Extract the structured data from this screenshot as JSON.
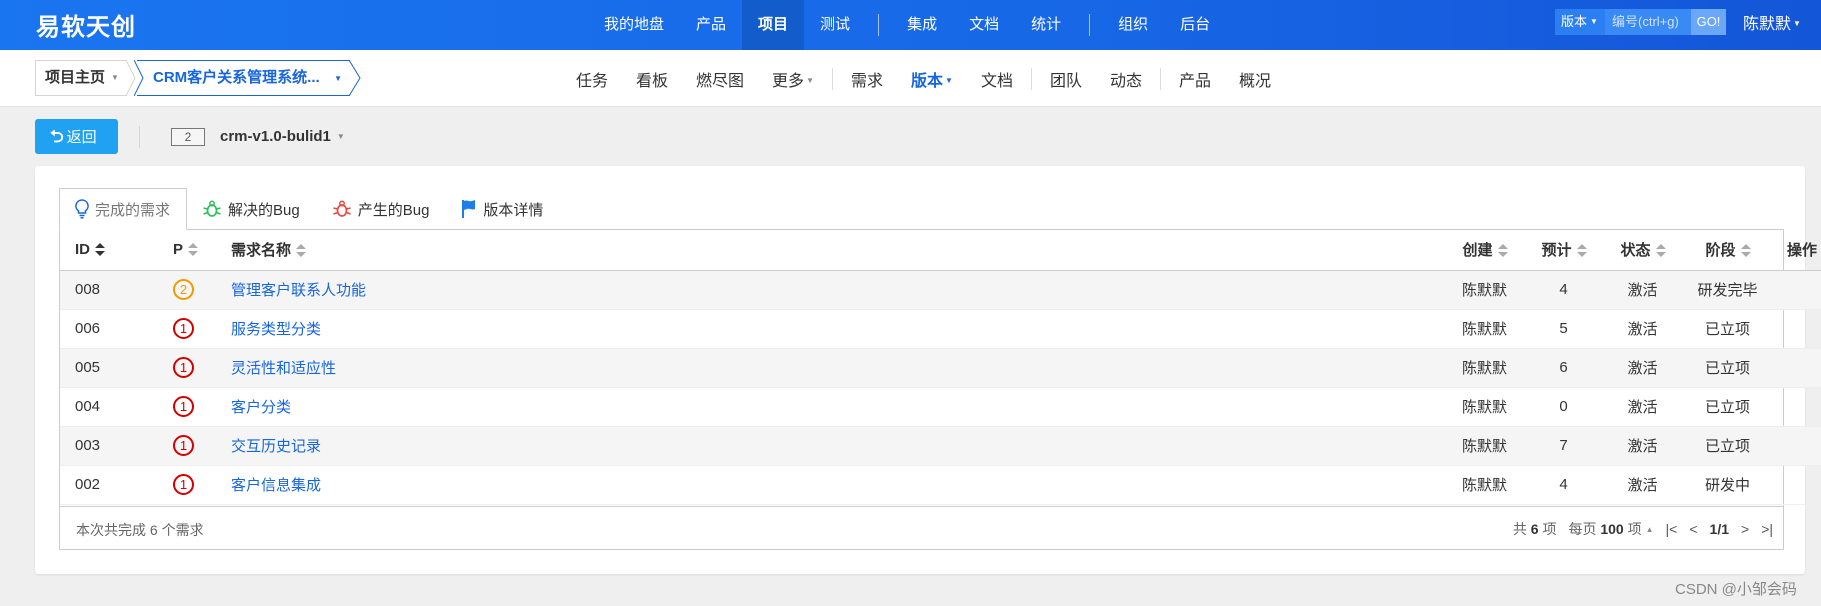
{
  "header": {
    "brand": "易软天创",
    "nav": [
      {
        "label": "我的地盘"
      },
      {
        "label": "产品"
      },
      {
        "label": "项目",
        "active": true
      },
      {
        "label": "测试"
      },
      {
        "label": "集成"
      },
      {
        "label": "文档"
      },
      {
        "label": "统计"
      },
      {
        "label": "组织"
      },
      {
        "label": "后台"
      }
    ],
    "search": {
      "type": "版本",
      "placeholder": "编号(ctrl+g)",
      "go": "GO!"
    },
    "user": "陈默默"
  },
  "subheader": {
    "home": "项目主页",
    "project": "CRM客户关系管理系统...",
    "nav": [
      {
        "label": "任务"
      },
      {
        "label": "看板"
      },
      {
        "label": "燃尽图"
      },
      {
        "label": "更多"
      },
      {
        "label": "需求"
      },
      {
        "label": "版本",
        "active": true
      },
      {
        "label": "文档"
      },
      {
        "label": "团队"
      },
      {
        "label": "动态"
      },
      {
        "label": "产品"
      },
      {
        "label": "概况"
      }
    ]
  },
  "toolbar": {
    "back": "返回",
    "version_id": "2",
    "version_name": "crm-v1.0-bulid1"
  },
  "tabs": [
    {
      "label": "完成的需求",
      "icon": "lightbulb-icon",
      "active": true
    },
    {
      "label": "解决的Bug",
      "icon": "bug-icon"
    },
    {
      "label": "产生的Bug",
      "icon": "bug-icon"
    },
    {
      "label": "版本详情",
      "icon": "flag-icon"
    }
  ],
  "table": {
    "columns": {
      "id": "ID",
      "pri": "P",
      "name": "需求名称",
      "creator": "创建",
      "estimate": "预计",
      "status": "状态",
      "stage": "阶段",
      "actions": "操作"
    },
    "rows": [
      {
        "id": "008",
        "pri": "2",
        "name": "管理客户联系人功能",
        "creator": "陈默默",
        "estimate": "4",
        "status": "激活",
        "stage": "研发完毕"
      },
      {
        "id": "006",
        "pri": "1",
        "name": "服务类型分类",
        "creator": "陈默默",
        "estimate": "5",
        "status": "激活",
        "stage": "已立项"
      },
      {
        "id": "005",
        "pri": "1",
        "name": "灵活性和适应性",
        "creator": "陈默默",
        "estimate": "6",
        "status": "激活",
        "stage": "已立项"
      },
      {
        "id": "004",
        "pri": "1",
        "name": "客户分类",
        "creator": "陈默默",
        "estimate": "0",
        "status": "激活",
        "stage": "已立项"
      },
      {
        "id": "003",
        "pri": "1",
        "name": "交互历史记录",
        "creator": "陈默默",
        "estimate": "7",
        "status": "激活",
        "stage": "已立项"
      },
      {
        "id": "002",
        "pri": "1",
        "name": "客户信息集成",
        "creator": "陈默默",
        "estimate": "4",
        "status": "激活",
        "stage": "研发中"
      }
    ],
    "summary": "本次共完成 6 个需求",
    "pager": {
      "total_prefix": "共",
      "total": "6",
      "total_suffix": "项",
      "per_prefix": "每页",
      "per": "100",
      "per_suffix": "项",
      "page": "1/1"
    }
  },
  "watermark": "CSDN @小邹会码"
}
